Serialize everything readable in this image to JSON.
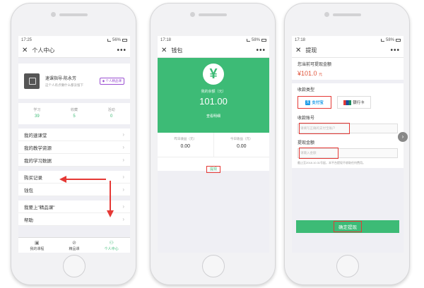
{
  "screen1": {
    "status_time": "17:25",
    "status_battery": "56%",
    "nav_title": "个人中心",
    "profile_name": "速课指导-陈永芳",
    "profile_sub": "这个人有点懒什么都没留下",
    "vip_label": "个人精品课",
    "stats": [
      {
        "label": "学习",
        "value": "39"
      },
      {
        "label": "收藏",
        "value": "5"
      },
      {
        "label": "活动",
        "value": "0"
      }
    ],
    "rows_a": [
      "我的速课堂",
      "我的教学资源",
      "我的学习数据"
    ],
    "rows_b": [
      "购买记录",
      "钱包"
    ],
    "rows_c": [
      "我要上\"精品课\"",
      "帮助"
    ],
    "tabs": [
      "我的课程",
      "精品课",
      "个人中心"
    ]
  },
  "screen2": {
    "status_time": "17:18",
    "status_battery": "58%",
    "nav_title": "钱包",
    "balance_label": "我的余额（元）",
    "balance": "101.00",
    "detail_link": "查看明细",
    "earn": [
      {
        "label": "昨日收益（元）",
        "value": "0.00"
      },
      {
        "label": "今日收益（元）",
        "value": "0.00"
      }
    ],
    "withdraw_link": "提现"
  },
  "screen3": {
    "status_time": "17:18",
    "status_battery": "58%",
    "nav_title": "提现",
    "available_label": "您当前可提现金额",
    "amount": "¥101.0",
    "amount_unit": "元",
    "type_label": "收款类型",
    "alipay_label": "支付宝",
    "unionpay_label": "银行卡",
    "account_label": "收款账号",
    "account_placeholder": "请填写正确的支付宝账户",
    "withdraw_amount_label": "提现金额",
    "amount_placeholder": "请输入金额",
    "note": "截止至2018.10.31号起，本平台提现不收取任何费用。",
    "confirm_label": "确定提现"
  },
  "colors": {
    "accent": "#3dbb76",
    "highlight": "#e53935"
  }
}
